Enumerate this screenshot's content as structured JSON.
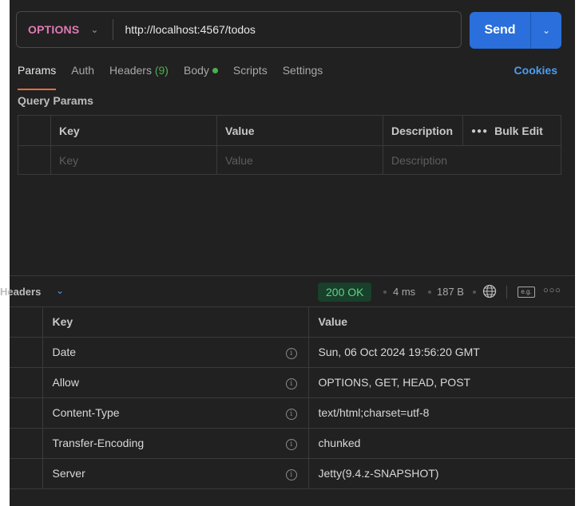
{
  "request": {
    "method": "OPTIONS",
    "url": "http://localhost:4567/todos",
    "send_label": "Send"
  },
  "tabs": [
    {
      "label": "Params",
      "active": true
    },
    {
      "label": "Auth"
    },
    {
      "label": "Headers",
      "count": "(9)"
    },
    {
      "label": "Body"
    },
    {
      "label": "Scripts"
    },
    {
      "label": "Settings"
    }
  ],
  "cookies_label": "Cookies",
  "query_params": {
    "title": "Query Params",
    "columns": [
      "Key",
      "Value",
      "Description"
    ],
    "bulk_edit": "Bulk Edit",
    "placeholders": [
      "Key",
      "Value",
      "Description"
    ]
  },
  "response": {
    "tab_label": "Headers",
    "status": "200 OK",
    "time": "4 ms",
    "size": "187 B",
    "columns": [
      "Key",
      "Value"
    ],
    "headers": [
      {
        "key": "Date",
        "value": "Sun, 06 Oct 2024 19:56:20 GMT"
      },
      {
        "key": "Allow",
        "value": "OPTIONS, GET, HEAD, POST"
      },
      {
        "key": "Content-Type",
        "value": "text/html;charset=utf-8"
      },
      {
        "key": "Transfer-Encoding",
        "value": "chunked"
      },
      {
        "key": "Server",
        "value": "Jetty(9.4.z-SNAPSHOT)"
      }
    ]
  },
  "colors": {
    "accent": "#2a6fdb",
    "method": "#e07ab4",
    "status_ok": "#5fd38a",
    "active_tab": "#f26b3a",
    "link": "#4a9df2"
  }
}
